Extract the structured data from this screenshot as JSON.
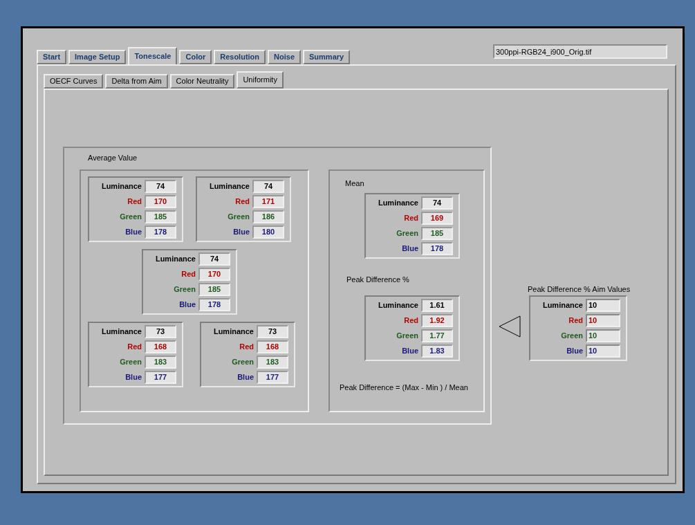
{
  "tabs": [
    {
      "label": "Start",
      "selected": false
    },
    {
      "label": "Image Setup",
      "selected": false
    },
    {
      "label": "Tonescale",
      "selected": true
    },
    {
      "label": "Color",
      "selected": false
    },
    {
      "label": "Resolution",
      "selected": false
    },
    {
      "label": "Noise",
      "selected": false
    },
    {
      "label": "Summary",
      "selected": false
    }
  ],
  "file_field": {
    "value": "300ppi-RGB24_i900_Orig.tif"
  },
  "subtabs": [
    {
      "label": "OECF Curves",
      "selected": false
    },
    {
      "label": "Delta from Aim",
      "selected": false
    },
    {
      "label": "Color Neutrality",
      "selected": false
    },
    {
      "label": "Uniformity",
      "selected": true
    }
  ],
  "average": {
    "title": "Average Value",
    "clusters": [
      {
        "readings": [
          {
            "label": "Luminance",
            "value": "74",
            "color": "#000000"
          },
          {
            "label": "Red",
            "value": "170",
            "color": "#b00000"
          },
          {
            "label": "Green",
            "value": "185",
            "color": "#1f5a1f"
          },
          {
            "label": "Blue",
            "value": "178",
            "color": "#1a1a7a"
          }
        ]
      },
      {
        "readings": [
          {
            "label": "Luminance",
            "value": "74",
            "color": "#000000"
          },
          {
            "label": "Red",
            "value": "171",
            "color": "#b00000"
          },
          {
            "label": "Green",
            "value": "186",
            "color": "#1f5a1f"
          },
          {
            "label": "Blue",
            "value": "180",
            "color": "#1a1a7a"
          }
        ]
      },
      {
        "readings": [
          {
            "label": "Luminance",
            "value": "74",
            "color": "#000000"
          },
          {
            "label": "Red",
            "value": "170",
            "color": "#b00000"
          },
          {
            "label": "Green",
            "value": "185",
            "color": "#1f5a1f"
          },
          {
            "label": "Blue",
            "value": "178",
            "color": "#1a1a7a"
          }
        ]
      },
      {
        "readings": [
          {
            "label": "Luminance",
            "value": "73",
            "color": "#000000"
          },
          {
            "label": "Red",
            "value": "168",
            "color": "#b00000"
          },
          {
            "label": "Green",
            "value": "183",
            "color": "#1f5a1f"
          },
          {
            "label": "Blue",
            "value": "177",
            "color": "#1a1a7a"
          }
        ]
      },
      {
        "readings": [
          {
            "label": "Luminance",
            "value": "73",
            "color": "#000000"
          },
          {
            "label": "Red",
            "value": "168",
            "color": "#b00000"
          },
          {
            "label": "Green",
            "value": "183",
            "color": "#1f5a1f"
          },
          {
            "label": "Blue",
            "value": "177",
            "color": "#1a1a7a"
          }
        ]
      }
    ]
  },
  "mean": {
    "title": "Mean",
    "readings": [
      {
        "label": "Luminance",
        "value": "74",
        "color": "#000000"
      },
      {
        "label": "Red",
        "value": "169",
        "color": "#b00000"
      },
      {
        "label": "Green",
        "value": "185",
        "color": "#1f5a1f"
      },
      {
        "label": "Blue",
        "value": "178",
        "color": "#1a1a7a"
      }
    ]
  },
  "peak": {
    "title": "Peak Difference %",
    "readings": [
      {
        "label": "Luminance",
        "value": "1.61",
        "color": "#000000"
      },
      {
        "label": "Red",
        "value": "1.92",
        "color": "#b00000"
      },
      {
        "label": "Green",
        "value": "1.77",
        "color": "#1f5a1f"
      },
      {
        "label": "Blue",
        "value": "1.83",
        "color": "#1a1a7a"
      }
    ]
  },
  "formula": "Peak Difference = (Max - Min ) / Mean",
  "aim": {
    "title": "Peak Difference % Aim Values",
    "readings": [
      {
        "label": "Luminance",
        "value": "10",
        "color": "#000000"
      },
      {
        "label": "Red",
        "value": "10",
        "color": "#b00000"
      },
      {
        "label": "Green",
        "value": "10",
        "color": "#1f5a1f"
      },
      {
        "label": "Blue",
        "value": "10",
        "color": "#1a1a7a"
      }
    ]
  }
}
